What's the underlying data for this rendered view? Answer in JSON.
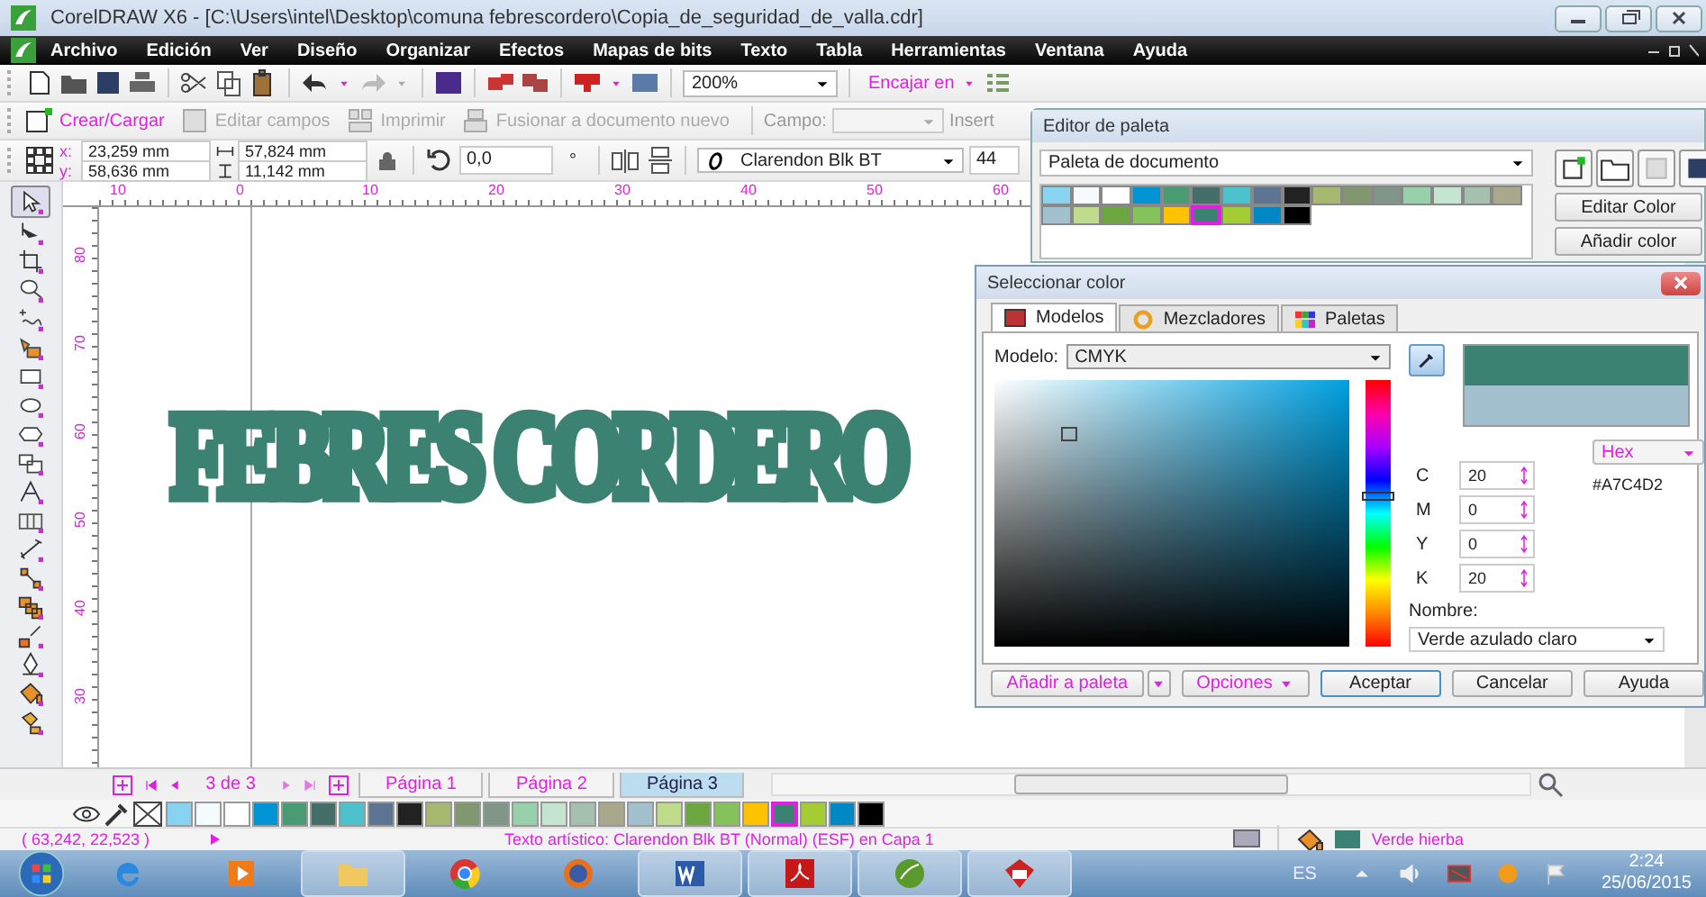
{
  "window": {
    "title": "CorelDRAW X6 - [C:\\Users\\intel\\Desktop\\comuna febrescordero\\Copia_de_seguridad_de_valla.cdr]"
  },
  "menu": [
    "Archivo",
    "Edición",
    "Ver",
    "Diseño",
    "Organizar",
    "Efectos",
    "Mapas de bits",
    "Texto",
    "Tabla",
    "Herramientas",
    "Ventana",
    "Ayuda"
  ],
  "toolbar": {
    "zoom": "200%",
    "snap": "Encajar en"
  },
  "merge_bar": {
    "items": [
      {
        "label": "Crear/Cargar",
        "disabled": false
      },
      {
        "label": "Editar campos",
        "disabled": true
      },
      {
        "label": "Imprimir",
        "disabled": true
      },
      {
        "label": "Fusionar a documento nuevo",
        "disabled": true
      }
    ],
    "field_label": "Campo:",
    "cut_label": "Insert"
  },
  "property_bar": {
    "x_label": "x:",
    "x": "23,259 mm",
    "y_label": "y:",
    "y": "58,636 mm",
    "width": "57,824 mm",
    "height": "11,142 mm",
    "angle": "0,0",
    "degree": "°",
    "font": "Clarendon Blk BT",
    "size": "44"
  },
  "ruler": {
    "h_labels": [
      "10",
      "0",
      "10",
      "20",
      "30",
      "40",
      "50",
      "60"
    ],
    "v_labels": [
      "80",
      "70",
      "60",
      "50",
      "40",
      "30"
    ]
  },
  "canvas": {
    "text": "FEBRES CORDERO"
  },
  "palette_editor": {
    "title": "Editor de paleta",
    "palette": "Paleta de documento",
    "buttons": [
      "Editar Color",
      "Añadir color"
    ],
    "swatches": [
      {
        "color": "#87d3f0",
        "selected": false
      },
      {
        "color": "#f5fafd",
        "selected": false
      },
      {
        "color": "#ffffff",
        "selected": false
      },
      {
        "color": "#0094d4",
        "selected": false
      },
      {
        "color": "#4a9a72",
        "selected": false
      },
      {
        "color": "#456e6b",
        "selected": false
      },
      {
        "color": "#4dc2cc",
        "selected": false
      },
      {
        "color": "#5d7592",
        "selected": false
      },
      {
        "color": "#222222",
        "selected": false
      },
      {
        "color": "#a6b86f",
        "selected": false
      },
      {
        "color": "#819770",
        "selected": false
      },
      {
        "color": "#7f9689",
        "selected": false
      },
      {
        "color": "#97d0aa",
        "selected": false
      },
      {
        "color": "#c5e5d0",
        "selected": false
      },
      {
        "color": "#a5c0af",
        "selected": false
      },
      {
        "color": "#a9a78c",
        "selected": false
      },
      {
        "color": "#a3c0cf",
        "selected": false
      },
      {
        "color": "#bfdc8c",
        "selected": false
      },
      {
        "color": "#6ba641",
        "selected": false
      },
      {
        "color": "#86c25b",
        "selected": false
      },
      {
        "color": "#fec200",
        "selected": false
      },
      {
        "color": "#3b8272",
        "selected": true
      },
      {
        "color": "#a4cc35",
        "selected": false
      },
      {
        "color": "#0088c6",
        "selected": false
      },
      {
        "color": "#000000",
        "selected": false
      }
    ]
  },
  "color_dialog": {
    "title": "Seleccionar color",
    "tabs": [
      {
        "label": "Modelos",
        "selected": true
      },
      {
        "label": "Mezcladores",
        "selected": false
      },
      {
        "label": "Paletas",
        "selected": false
      }
    ],
    "model_label": "Modelo:",
    "model": "CMYK",
    "hue_slider": {
      "level": 0.56
    },
    "hex_mode": "Hex",
    "hex": "#A7C4D2",
    "channels": [
      {
        "label": "C",
        "value": "20"
      },
      {
        "label": "M",
        "value": "0"
      },
      {
        "label": "Y",
        "value": "0"
      },
      {
        "label": "K",
        "value": "20"
      }
    ],
    "name_label": "Nombre:",
    "name": "Verde azulado claro",
    "buttons": [
      {
        "label": "Añadir a paleta",
        "kind": "split"
      },
      {
        "label": "Opciones",
        "kind": "menu"
      },
      {
        "label": "Aceptar",
        "kind": "default"
      },
      {
        "label": "Cancelar",
        "kind": "plain"
      },
      {
        "label": "Ayuda",
        "kind": "plain"
      }
    ]
  },
  "page_nav": {
    "counter": "3 de 3",
    "pages": [
      {
        "label": "Página 1",
        "selected": false
      },
      {
        "label": "Página 2",
        "selected": false
      },
      {
        "label": "Página 3",
        "selected": true
      }
    ]
  },
  "color_bar": {
    "swatches": [
      {
        "color": "#87d3f0",
        "selected": false
      },
      {
        "color": "#f5fafd",
        "selected": false
      },
      {
        "color": "#ffffff",
        "selected": false
      },
      {
        "color": "#0094d4",
        "selected": false
      },
      {
        "color": "#4a9a72",
        "selected": false
      },
      {
        "color": "#456e6b",
        "selected": false
      },
      {
        "color": "#4dc2cc",
        "selected": false
      },
      {
        "color": "#5d7592",
        "selected": false
      },
      {
        "color": "#222222",
        "selected": false
      },
      {
        "color": "#a6b86f",
        "selected": false
      },
      {
        "color": "#819770",
        "selected": false
      },
      {
        "color": "#7f9689",
        "selected": false
      },
      {
        "color": "#97d0aa",
        "selected": false
      },
      {
        "color": "#c5e5d0",
        "selected": false
      },
      {
        "color": "#a5c0af",
        "selected": false
      },
      {
        "color": "#a9a78c",
        "selected": false
      },
      {
        "color": "#a3c0cf",
        "selected": false
      },
      {
        "color": "#bfdc8c",
        "selected": false
      },
      {
        "color": "#6ba641",
        "selected": false
      },
      {
        "color": "#86c25b",
        "selected": false
      },
      {
        "color": "#fec200",
        "selected": false
      },
      {
        "color": "#3b8272",
        "selected": true
      },
      {
        "color": "#a4cc35",
        "selected": false
      },
      {
        "color": "#0088c6",
        "selected": false
      },
      {
        "color": "#000000",
        "selected": false
      }
    ]
  },
  "status_bar": {
    "coords": "( 63,242, 22,523 )",
    "info": "Texto artístico: Clarendon Blk BT (Normal) (ESF) en Capa 1",
    "fill_name": "Verde hierba"
  },
  "taskbar": {
    "language": "ES",
    "time": "2:24",
    "date": "25/06/2015"
  }
}
